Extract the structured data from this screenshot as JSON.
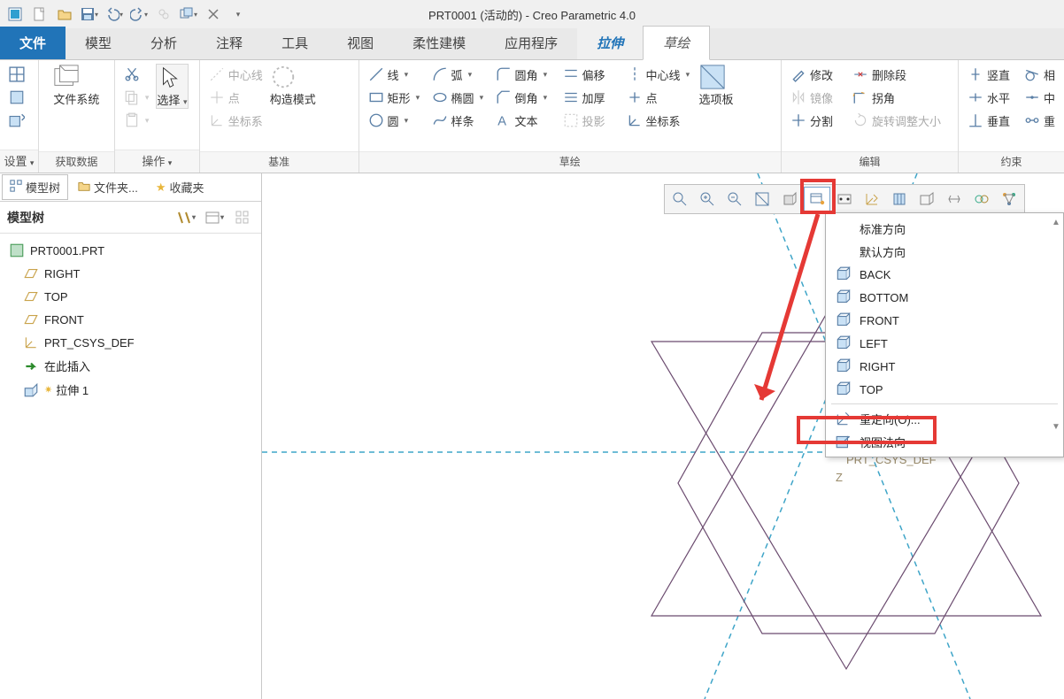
{
  "title": {
    "doc": "PRT0001",
    "status": "(活动的)",
    "sep": " - ",
    "app": "Creo Parametric 4.0"
  },
  "ribbon_tabs": {
    "file": "文件",
    "items": [
      "模型",
      "分析",
      "注释",
      "工具",
      "视图",
      "柔性建模",
      "应用程序",
      "拉伸",
      "草绘"
    ]
  },
  "groups": {
    "settings": {
      "label": "设置",
      "drop": "▾"
    },
    "getdata": {
      "label": "获取数据",
      "filesys": "文件系统"
    },
    "operate": {
      "label": "操作",
      "select": "选择",
      "drop": "▾"
    },
    "datum": {
      "label": "基准",
      "centerline": "中心线",
      "point": "点",
      "csys": "坐标系",
      "mode": "构造模式"
    },
    "sketch": {
      "label": "草绘",
      "r1": {
        "line": "线",
        "arc": "弧",
        "fillet": "圆角",
        "offset": "偏移",
        "c_centerline": "中心线"
      },
      "r2": {
        "rect": "矩形",
        "ellipse": "椭圆",
        "chamfer": "倒角",
        "thicken": "加厚",
        "c_point": "点"
      },
      "r3": {
        "circle": "圆",
        "spline": "样条",
        "text": "文本",
        "project": "投影",
        "c_csys": "坐标系"
      },
      "palette": "选项板"
    },
    "edit": {
      "label": "编辑",
      "modify": "修改",
      "delete_seg": "删除段",
      "mirror": "镜像",
      "corner": "拐角",
      "divide": "分割",
      "rotate_resize": "旋转调整大小"
    },
    "constrain": {
      "label": "约束",
      "vertical": "竖直",
      "tangent": "相",
      "horizontal": "水平",
      "midpt": "中",
      "perp": "垂直",
      "sym": "重"
    }
  },
  "browser": {
    "tabs": {
      "model_tree": "模型树",
      "folders": "文件夹...",
      "favorites": "收藏夹"
    },
    "tree_title": "模型树",
    "items": {
      "root": "PRT0001.PRT",
      "right": "RIGHT",
      "top": "TOP",
      "front": "FRONT",
      "csys": "PRT_CSYS_DEF",
      "insert_here": "在此插入",
      "extrude": "拉伸 1"
    }
  },
  "canvas": {
    "csys_label": "PRT_CSYS_DEF",
    "axis_z": "Z"
  },
  "view_menu": {
    "standard": "标准方向",
    "default": "默认方向",
    "back": "BACK",
    "bottom": "BOTTOM",
    "front": "FRONT",
    "left": "LEFT",
    "right": "RIGHT",
    "top": "TOP",
    "reorient": "重定向(O)...",
    "normal": "视图法向"
  }
}
